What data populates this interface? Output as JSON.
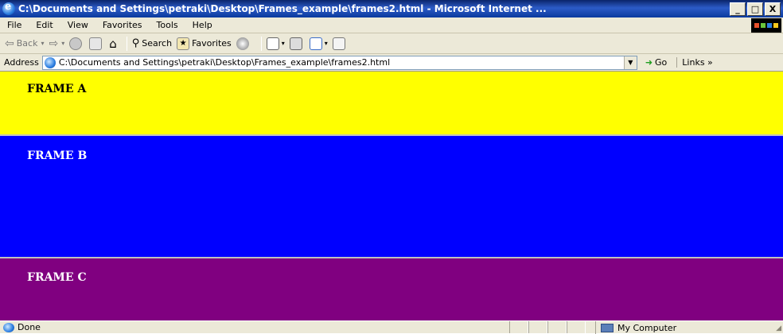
{
  "window": {
    "title": "C:\\Documents and Settings\\petraki\\Desktop\\Frames_example\\frames2.html - Microsoft Internet ...",
    "minimize": "_",
    "maximize": "□",
    "close": "X"
  },
  "menu": {
    "file": "File",
    "edit": "Edit",
    "view": "View",
    "favorites": "Favorites",
    "tools": "Tools",
    "help": "Help"
  },
  "toolbar": {
    "back": "Back",
    "search": "Search",
    "favorites": "Favorites"
  },
  "address": {
    "label": "Address",
    "url": "C:\\Documents and Settings\\petraki\\Desktop\\Frames_example\\frames2.html",
    "go": "Go",
    "links": "Links »"
  },
  "frames": {
    "a": {
      "label": "FRAME A",
      "bg": "#ffff00",
      "fg": "#000000"
    },
    "b": {
      "label": "FRAME B",
      "bg": "#0000ff",
      "fg": "#ffffff"
    },
    "c": {
      "label": "FRAME C",
      "bg": "#800080",
      "fg": "#ffffff"
    }
  },
  "status": {
    "text": "Done",
    "zone": "My Computer"
  }
}
